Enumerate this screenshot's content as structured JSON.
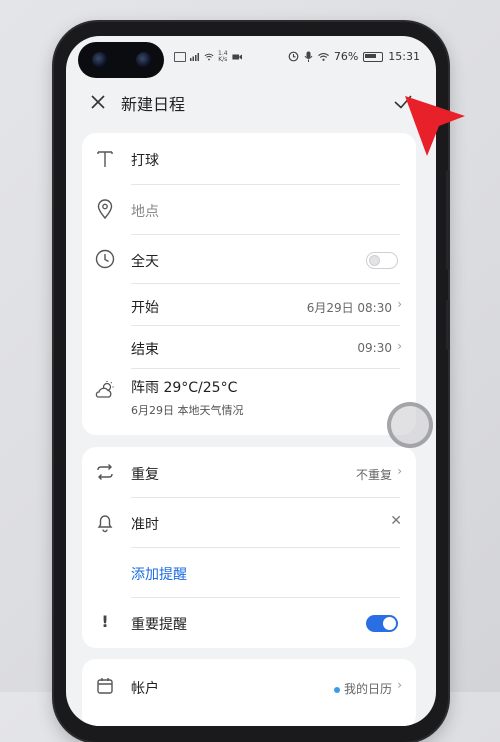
{
  "status_bar": {
    "speed": "1.4\nK/s",
    "battery_pct": "76%",
    "time": "15:31"
  },
  "header": {
    "title": "新建日程"
  },
  "form": {
    "title_value": "打球",
    "location_placeholder": "地点",
    "all_day_label": "全天",
    "all_day_on": false,
    "start_label": "开始",
    "start_value": "6月29日 08:30",
    "end_label": "结束",
    "end_value": "09:30",
    "weather_title": "阵雨 29°C/25°C",
    "weather_sub": "6月29日 本地天气情况",
    "repeat_label": "重复",
    "repeat_value": "不重复",
    "reminder_label": "准时",
    "add_reminder": "添加提醒",
    "important_label": "重要提醒",
    "important_on": true,
    "account_label": "帐户",
    "account_value": "我的日历"
  },
  "icons": {
    "close": "close-icon",
    "confirm": "check-icon",
    "title": "text-icon",
    "location": "location-pin-icon",
    "all_day": "clock-icon",
    "weather": "partly-cloudy-icon",
    "repeat": "repeat-icon",
    "reminder": "bell-icon",
    "important": "exclamation-icon",
    "account": "calendar-icon"
  },
  "colors": {
    "accent": "#2a6ee6",
    "link": "#1e6fe0",
    "annotation_arrow": "#e8202a"
  }
}
